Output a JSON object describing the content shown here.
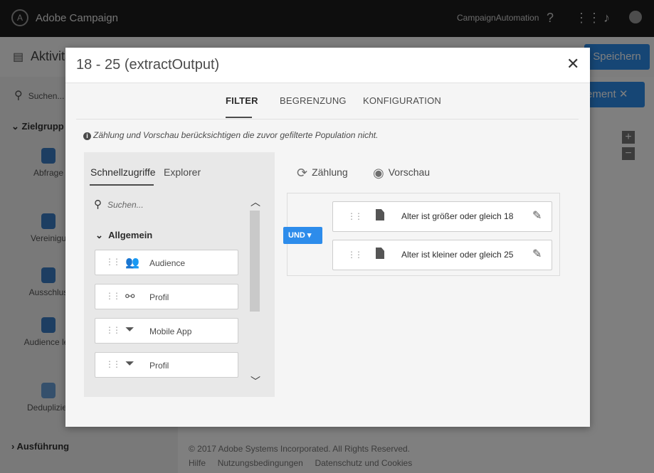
{
  "app": {
    "name": "Adobe Campaign",
    "instance": "CampaignAutomation",
    "page_title": "Aktivitä",
    "save_label": "Speichern",
    "search_placeholder": "Suchen...",
    "filter_pill": "ement",
    "left_panel": {
      "sections": [
        "Zielgrupp",
        "Ausführung"
      ],
      "items": [
        "Abfrage",
        "Vereinigu",
        "Ausschlus",
        "Audience les",
        "Deduplizier"
      ]
    },
    "footer": {
      "copyright": "© 2017 Adobe Systems Incorporated. All Rights Reserved.",
      "links": [
        "Hilfe",
        "Nutzungsbedingungen",
        "Datenschutz und Cookies"
      ]
    }
  },
  "modal": {
    "title": "18 - 25 (extractOutput)",
    "tabs": [
      "FILTER",
      "BEGRENZUNG",
      "KONFIGURATION"
    ],
    "info": "Zählung und Vorschau berücksichtigen die zuvor gefilterte Population nicht.",
    "palette": {
      "tabs": [
        "Schnellzugriffe",
        "Explorer"
      ],
      "search_placeholder": "Suchen...",
      "group": "Allgemein",
      "items": [
        {
          "label": "Audience",
          "icon": "audience-icon"
        },
        {
          "label": "Profil",
          "icon": "link-icon"
        },
        {
          "label": "Mobile App",
          "icon": "funnel-icon"
        },
        {
          "label": "Profil",
          "icon": "funnel-icon"
        }
      ]
    },
    "actions": {
      "count": "Zählung",
      "preview": "Vorschau"
    },
    "operator": "UND",
    "conditions": [
      "Alter ist größer oder gleich 18",
      "Alter ist kleiner oder gleich 25"
    ]
  }
}
